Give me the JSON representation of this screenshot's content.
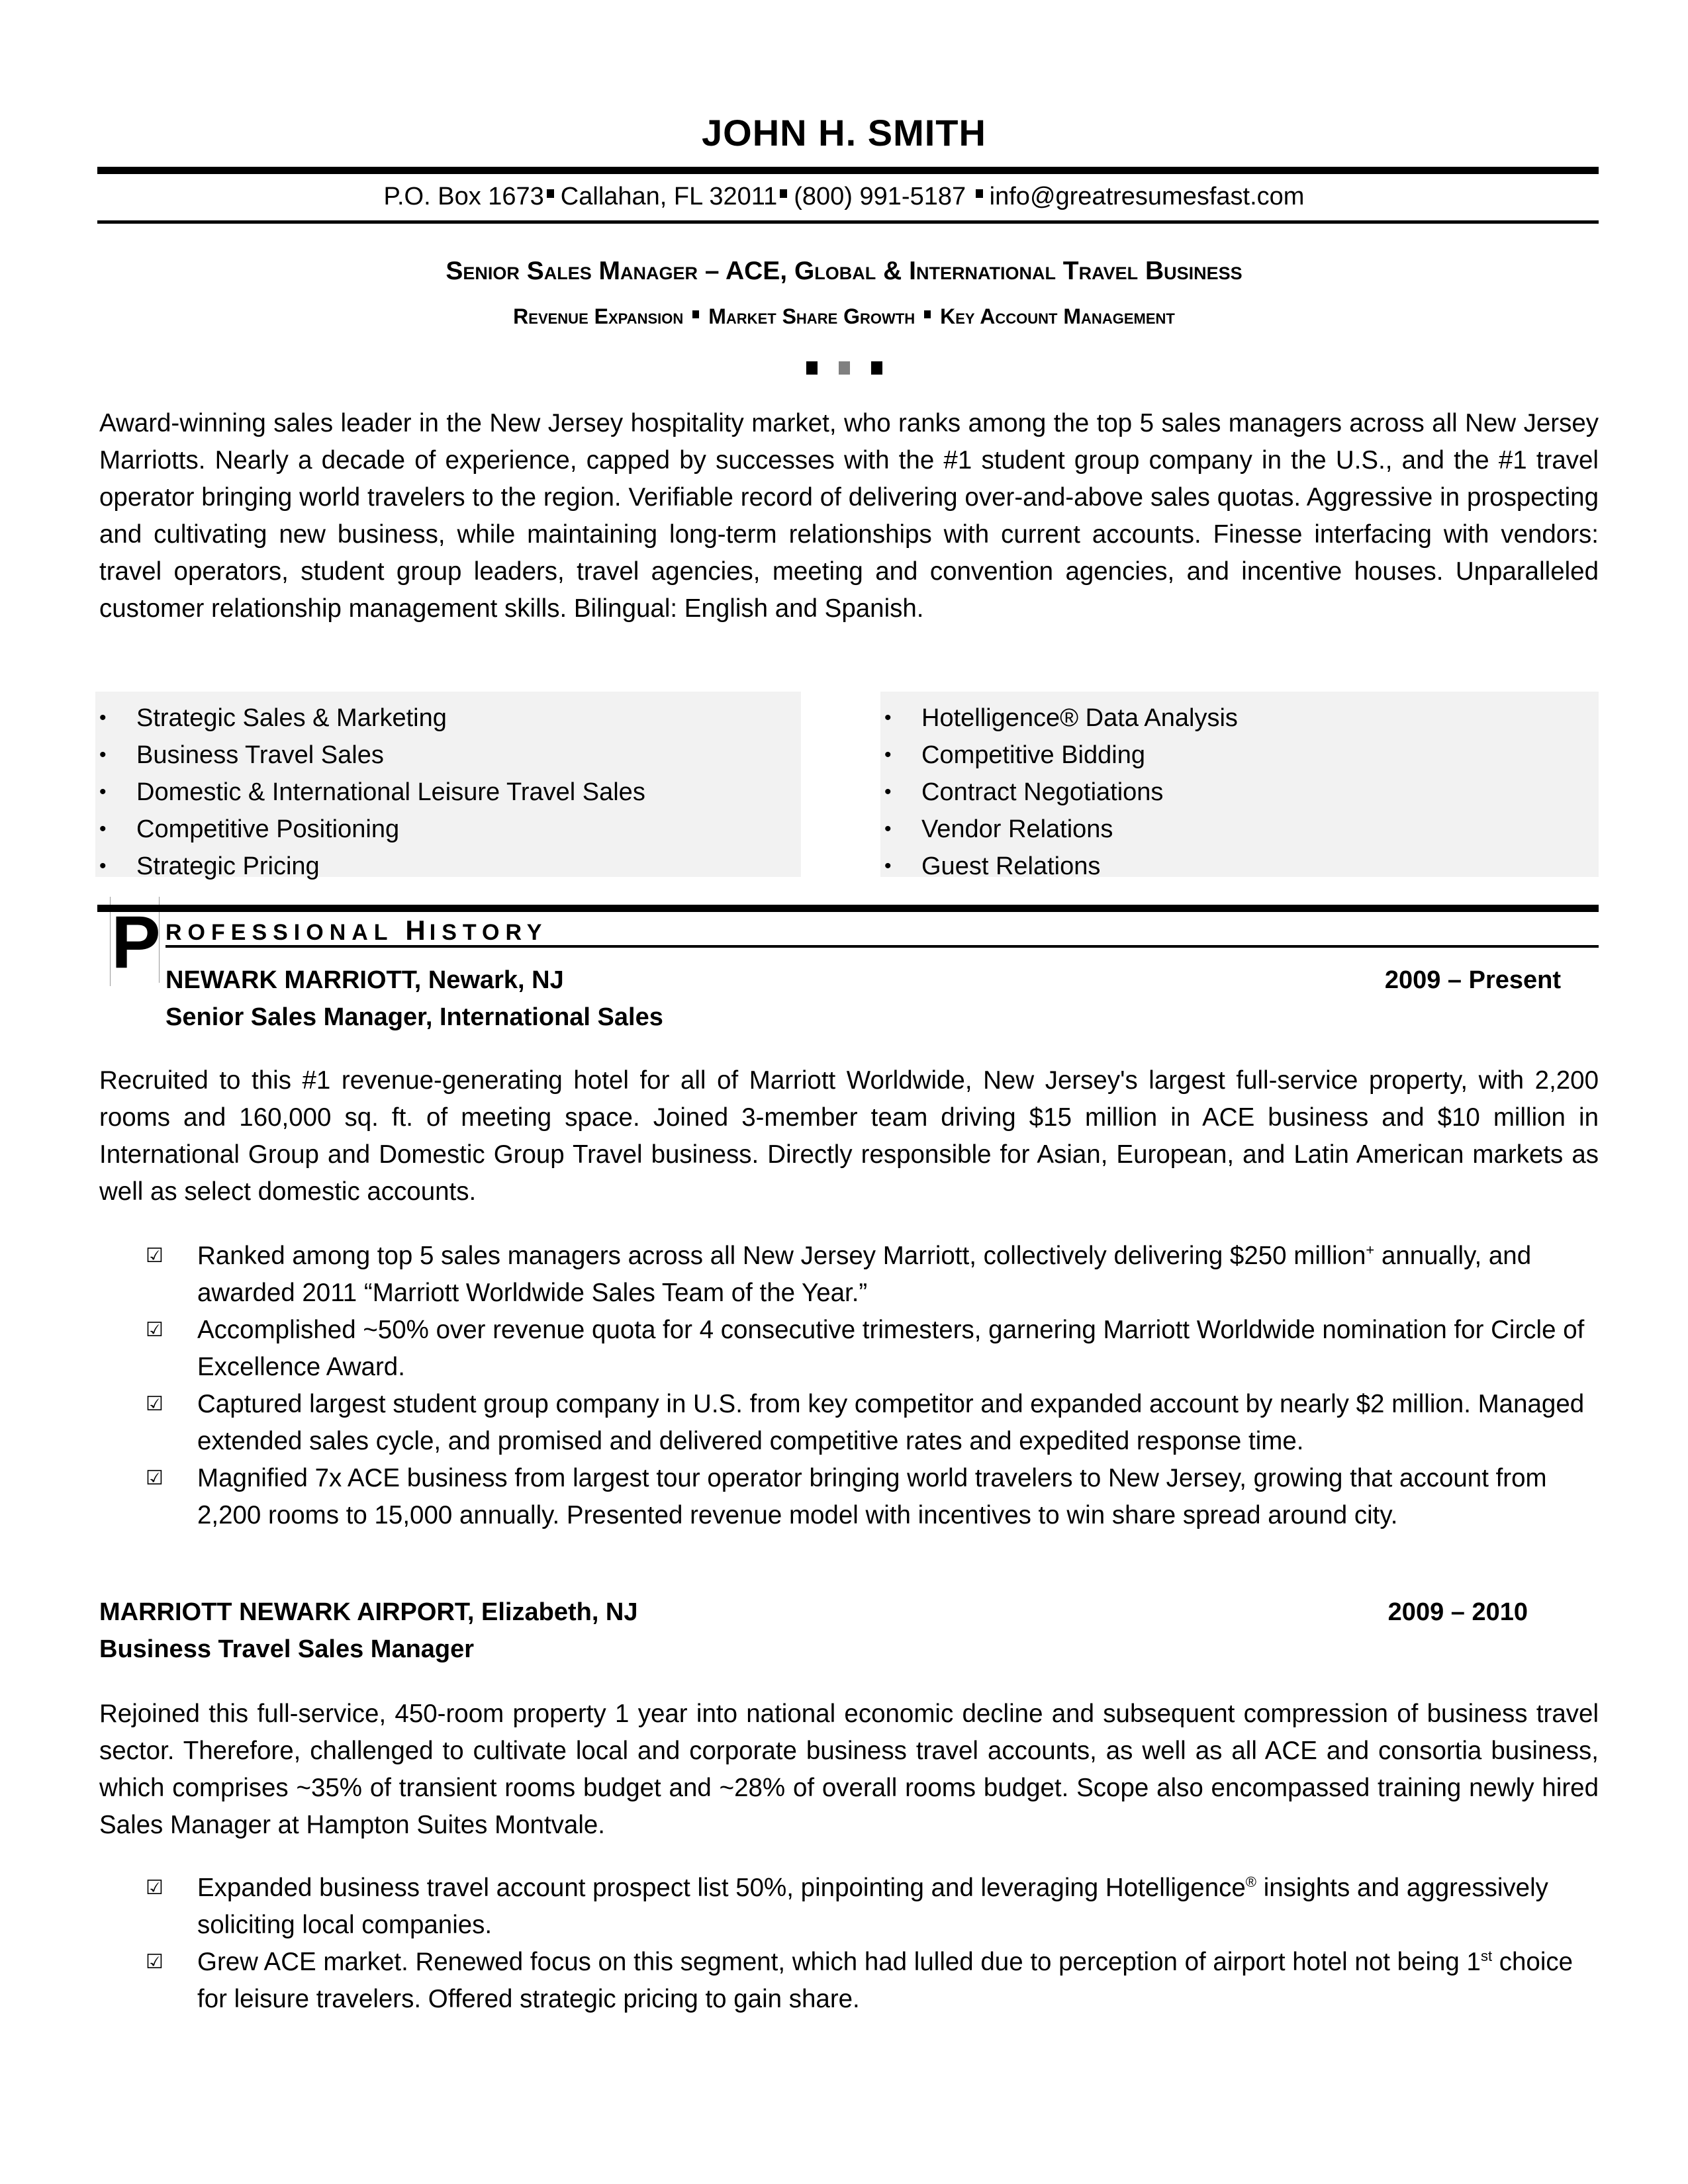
{
  "header": {
    "name": "JOHN H. SMITH",
    "contact": {
      "address": "P.O. Box 1673",
      "city": "Callahan, FL 32011",
      "phone": "(800) 991-5187",
      "email": "info@greatresumesfast.com"
    },
    "headline": "Senior Sales Manager – ACE, Global & International Travel Business",
    "subline": {
      "items": [
        "Revenue Expansion",
        "Market Share Growth",
        "Key Account Management"
      ]
    },
    "divider_colors": [
      "#000000",
      "#808080",
      "#000000"
    ]
  },
  "summary": "Award-winning sales leader in the New Jersey hospitality market, who ranks among the top 5 sales managers across all New Jersey Marriotts. Nearly a decade of experience, capped by successes with the #1 student group company in the U.S., and the #1 travel operator bringing world travelers to the region. Verifiable record of delivering over-and-above sales quotas. Aggressive in prospecting and cultivating new business, while maintaining long-term relationships with current accounts. Finesse interfacing with vendors: travel operators, student group leaders, travel agencies, meeting and convention agencies, and incentive houses. Unparalleled customer relationship management skills. Bilingual: English and Spanish.",
  "skills": {
    "left": [
      "Strategic Sales & Marketing",
      "Business Travel Sales",
      "Domestic & International Leisure Travel Sales",
      "Competitive Positioning",
      "Strategic Pricing"
    ],
    "right": [
      "Hotelligence® Data Analysis",
      "Competitive Bidding",
      "Contract Negotiations",
      "Vendor Relations",
      "Guest Relations"
    ],
    "bullet_icon": "•",
    "background": "#f2f2f2"
  },
  "history": {
    "title_initial": "P",
    "title_rest_1": "ROFESSIONAL",
    "title_cap_2": "H",
    "title_rest_2": "ISTORY",
    "check_icon": "☑",
    "jobs": [
      {
        "company": "NEWARK MARRIOTT, Newark, NJ",
        "dates": "2009 – Present",
        "title": "Senior Sales Manager, International Sales",
        "description": "Recruited to this #1 revenue-generating hotel for all of Marriott Worldwide, New Jersey's largest full-service property, with 2,200 rooms and 160,000 sq. ft. of meeting space. Joined 3-member team driving $15 million in ACE business and $10 million in International Group and Domestic Group Travel business. Directly responsible for Asian, European, and Latin American markets as well as select domestic accounts.",
        "achievements": [
          {
            "pre": "Ranked among top 5 sales managers across all New Jersey Marriott, collectively delivering  $250 million",
            "sup": "+",
            "post": " annually, and awarded 2011 “Marriott Worldwide Sales Team of the Year.”"
          },
          {
            "pre": "Accomplished ~50% over revenue quota for 4 consecutive trimesters, garnering Marriott Worldwide nomination for Circle of Excellence Award.",
            "sup": "",
            "post": ""
          },
          {
            "pre": "Captured largest student group company in U.S. from key competitor and expanded account by nearly $2 million. Managed extended sales cycle, and promised and delivered competitive rates and expedited response time.",
            "sup": "",
            "post": ""
          },
          {
            "pre": "Magnified 7x ACE business from largest tour operator bringing world travelers to New Jersey, growing that account from 2,200 rooms to 15,000 annually. Presented revenue model with incentives to win share spread around city.",
            "sup": "",
            "post": ""
          }
        ]
      },
      {
        "company": "MARRIOTT NEWARK AIRPORT, Elizabeth, NJ",
        "dates": "2009 – 2010",
        "title": "Business Travel Sales Manager",
        "description": "Rejoined this full-service, 450-room property 1 year into national economic decline and subsequent compression of business travel sector. Therefore, challenged to cultivate local and corporate business travel accounts, as well as all ACE and consortia business, which comprises ~35% of transient rooms budget and ~28% of overall rooms budget. Scope also encompassed training newly hired Sales Manager at Hampton Suites Montvale.",
        "achievements": [
          {
            "pre": "Expanded business travel account prospect list 50%, pinpointing and leveraging Hotelligence",
            "sup": "®",
            "post": " insights and aggressively soliciting local companies."
          },
          {
            "pre": "Grew ACE market. Renewed focus on this segment, which had lulled due to perception of airport hotel not being 1",
            "sup": "st",
            "post": " choice for leisure travelers. Offered strategic pricing to gain share."
          }
        ]
      }
    ]
  }
}
